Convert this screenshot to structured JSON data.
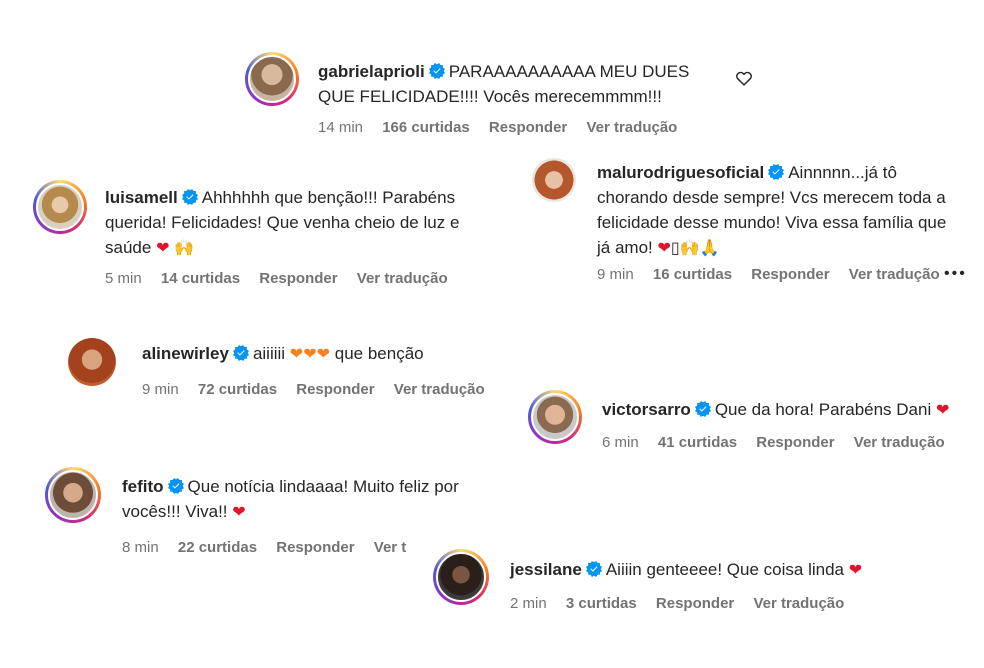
{
  "comments": [
    {
      "username": "gabrielaprioli",
      "text_line1": "PARAAAAAAAAAA MEU DUES",
      "text_line2": "QUE FELICIDADE!!!! Vocês merecemmmm!!!",
      "time": "14 min",
      "likes": "166 curtidas",
      "reply": "Responder",
      "translate": "Ver tradução"
    },
    {
      "username": "luisamell",
      "text_line1": "Ahhhhhh que benção!!! Parabéns",
      "text_line2": "querida! Felicidades! Que venha cheio de luz e",
      "text_line3": "saúde",
      "time": "5 min",
      "likes": "14 curtidas",
      "reply": "Responder",
      "translate": "Ver tradução"
    },
    {
      "username": "malurodriguesoficial",
      "text_line1": "Ainnnnn...já tô",
      "text_line2": "chorando desde sempre! Vcs merecem toda a",
      "text_line3": "felicidade desse mundo! Viva essa família que",
      "text_line4": "já amo!",
      "time": "9 min",
      "likes": "16 curtidas",
      "reply": "Responder",
      "translate": "Ver tradução",
      "more": "•••"
    },
    {
      "username": "alinewirley",
      "text_line1": "aiiiiii",
      "text_line1_end": "que benção",
      "time": "9 min",
      "likes": "72 curtidas",
      "reply": "Responder",
      "translate": "Ver tradução"
    },
    {
      "username": "victorsarro",
      "text_line1": "Que da hora! Parabéns Dani",
      "time": "6 min",
      "likes": "41 curtidas",
      "reply": "Responder",
      "translate": "Ver tradução"
    },
    {
      "username": "fefito",
      "text_line1": "Que notícia lindaaaa! Muito feliz por",
      "text_line2": "vocês!!! Viva!!",
      "time": "8 min",
      "likes": "22 curtidas",
      "reply": "Responder",
      "translate": "Ver t"
    },
    {
      "username": "jessilane",
      "text_line1": "Aiiiin genteeee! Que coisa linda",
      "time": "2 min",
      "likes": "3 curtidas",
      "reply": "Responder",
      "translate": "Ver tradução"
    }
  ],
  "icons": {
    "verified": "verified-badge-icon",
    "heart_red": "❤",
    "heart_orange": "🧡",
    "raised_hands": "🙌",
    "pray": "🙏",
    "like": "heart-outline-icon"
  },
  "colors": {
    "verified": "#0095f6",
    "meta": "#737373",
    "text": "#262626"
  }
}
